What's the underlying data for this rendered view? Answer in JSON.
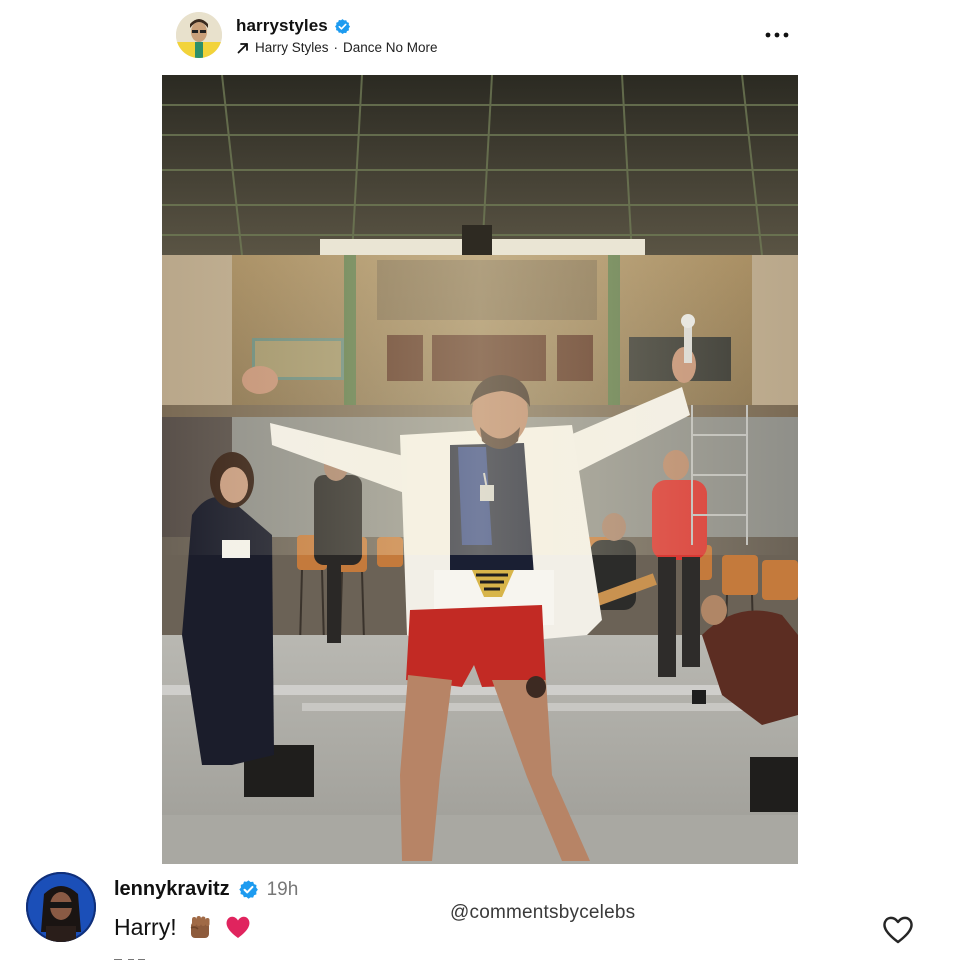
{
  "post": {
    "username": "harrystyles",
    "verified": true,
    "audio": {
      "artist": "Harry Styles",
      "separator": "·",
      "song": "Dance No More"
    },
    "more_icon": "ellipsis-icon"
  },
  "photo": {
    "scene": "rehearsal-hall-performer-photo"
  },
  "comment": {
    "username": "lennykravitz",
    "verified": true,
    "time": "19h",
    "text": "Harry!",
    "emojis": [
      "raised-fist-icon",
      "red-heart-icon"
    ],
    "like_icon": "heart-outline-icon"
  },
  "watermark": "@commentsbycelebs",
  "colors": {
    "verified_blue": "#1d9bf0",
    "heart_red": "#e0245e",
    "text_dark": "#111111",
    "text_muted": "#777777"
  }
}
